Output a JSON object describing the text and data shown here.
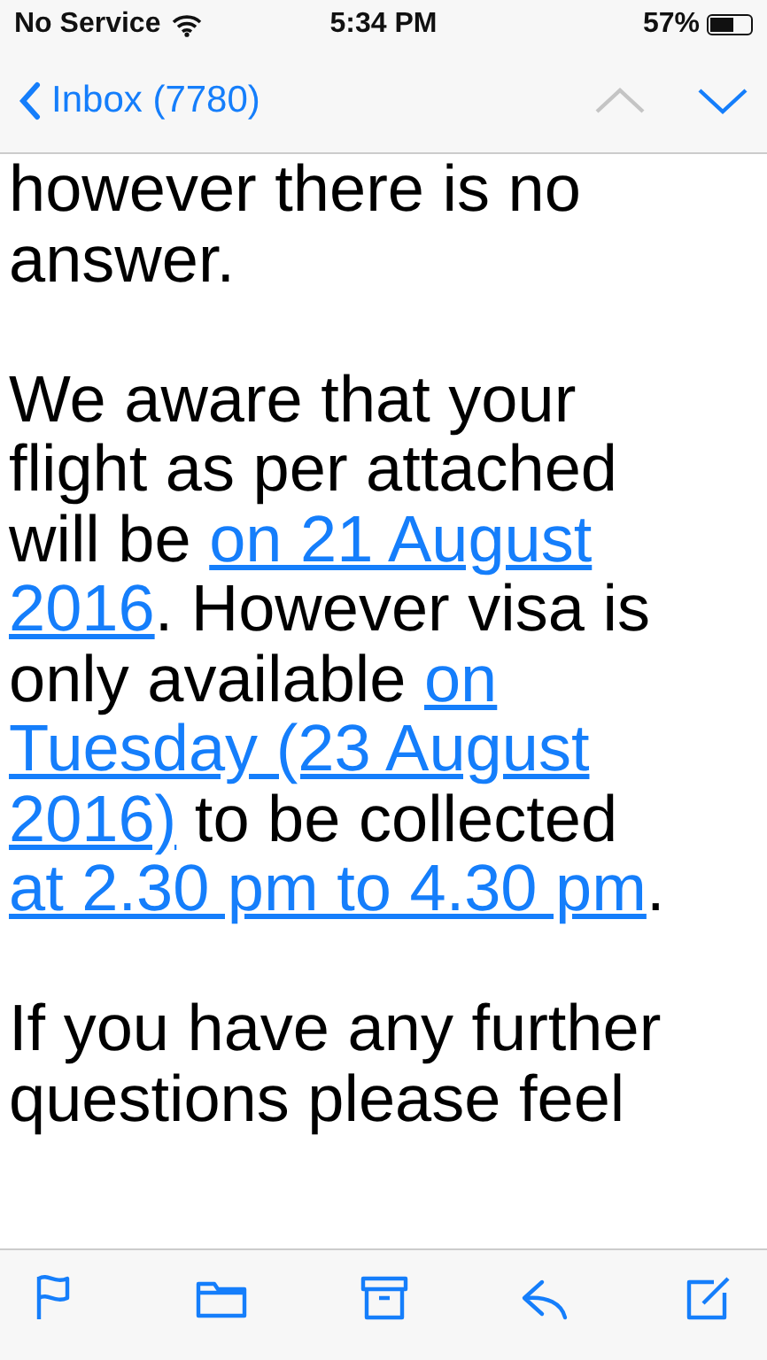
{
  "status_bar": {
    "carrier": "No Service",
    "time": "5:34 PM",
    "battery": "57%"
  },
  "nav_bar": {
    "back_label": "Inbox (7780)",
    "previous_disabled": true,
    "next_disabled": false
  },
  "message_body": [
    [
      [
        {
          "kind": "text",
          "text": "however there is no"
        }
      ],
      [
        {
          "kind": "text",
          "text": "answer."
        }
      ]
    ],
    [
      [
        {
          "kind": "text",
          "text": "We aware that your"
        }
      ],
      [
        {
          "kind": "text",
          "text": "flight as per attached"
        }
      ],
      [
        {
          "kind": "text",
          "text": "will be "
        },
        {
          "kind": "link",
          "text": "on 21 August"
        }
      ],
      [
        {
          "kind": "link",
          "text": "2016"
        },
        {
          "kind": "text",
          "text": ". However visa is"
        }
      ],
      [
        {
          "kind": "text",
          "text": "only available "
        },
        {
          "kind": "link",
          "text": "on"
        }
      ],
      [
        {
          "kind": "link",
          "text": "Tuesday (23 August"
        }
      ],
      [
        {
          "kind": "link",
          "text": "2016)"
        },
        {
          "kind": "text",
          "text": " to be collected"
        }
      ],
      [
        {
          "kind": "link",
          "text": "at 2.30 pm to 4.30 pm"
        },
        {
          "kind": "text",
          "text": "."
        }
      ]
    ],
    [
      [
        {
          "kind": "text",
          "text": "If you have any further"
        }
      ],
      [
        {
          "kind": "text",
          "text": "questions please feel"
        }
      ]
    ]
  ],
  "toolbar": [
    {
      "kind": "flag"
    },
    {
      "kind": "folder"
    },
    {
      "kind": "archive"
    },
    {
      "kind": "reply"
    },
    {
      "kind": "compose"
    }
  ]
}
